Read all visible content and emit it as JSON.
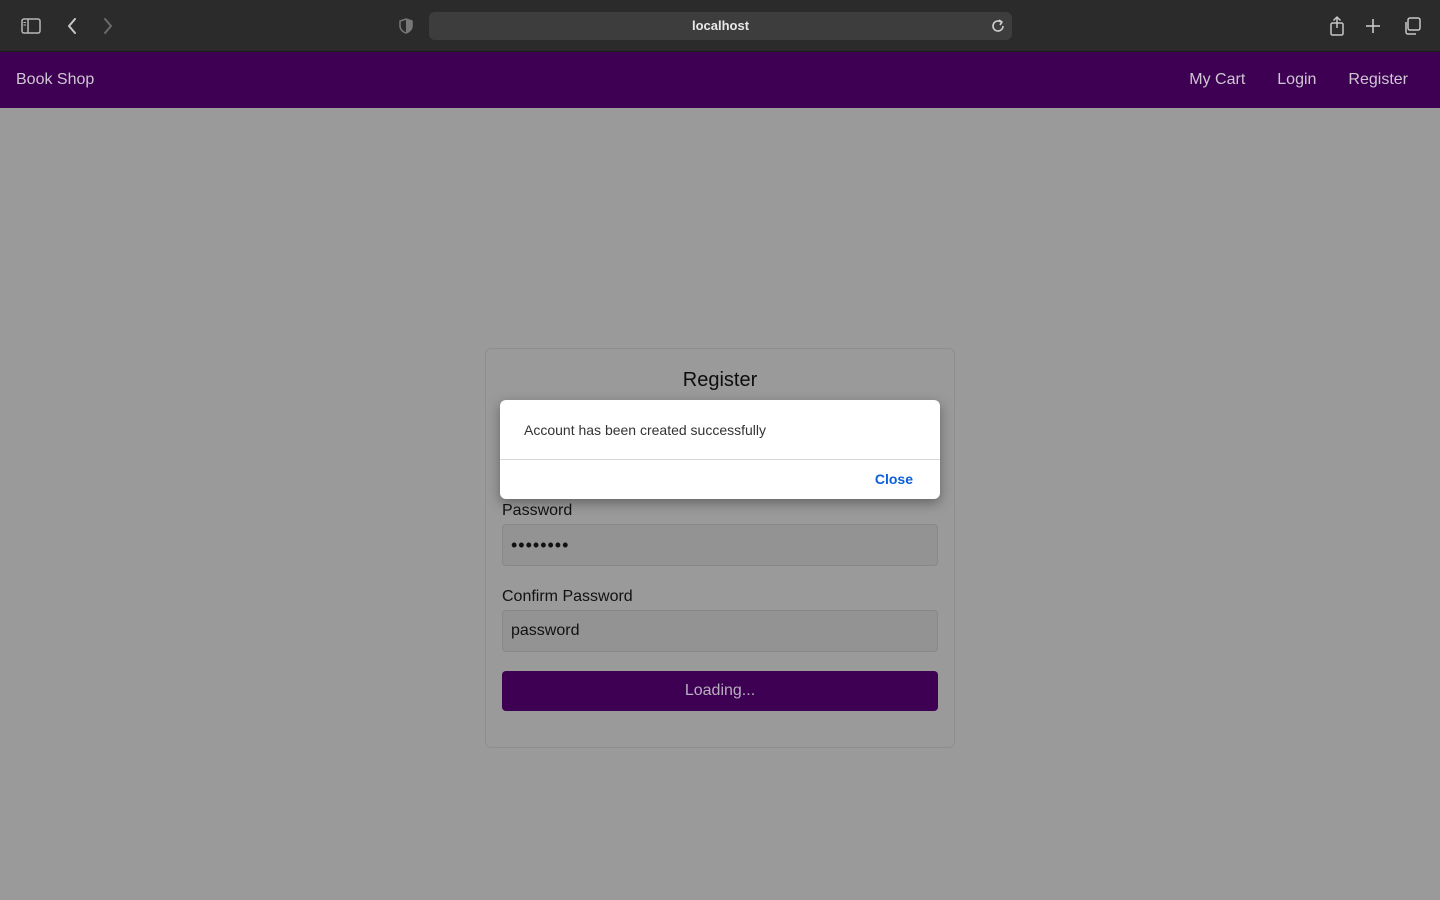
{
  "browser": {
    "url": "localhost",
    "icons": [
      "sidebar-icon",
      "back-icon",
      "forward-icon",
      "privacy-shield-icon",
      "reload-icon",
      "share-icon",
      "new-tab-icon",
      "tabs-overview-icon"
    ]
  },
  "navbar": {
    "brand": "Book Shop",
    "links": [
      "My Cart",
      "Login",
      "Register"
    ],
    "background": "#3d0052"
  },
  "register_form": {
    "title": "Register",
    "password_label": "Password",
    "password_value": "••••••••",
    "confirm_label": "Confirm Password",
    "confirm_value": "password",
    "submit_label": "Loading..."
  },
  "modal": {
    "message": "Account has been created successfully",
    "close_label": "Close"
  }
}
